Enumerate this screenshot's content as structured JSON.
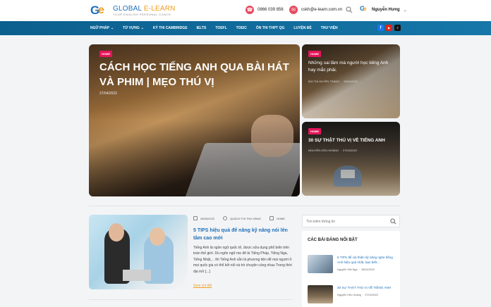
{
  "brand": {
    "logo_title": "GLOBAL",
    "logo_title_hl": "E-LEARN",
    "logo_sub": "YOUR ENGLISH PERSONAL COACH"
  },
  "header": {
    "phone": "0866 039 856",
    "email": "cskh@e-learn.com.vn",
    "user_name": "Nguyễn Hưng"
  },
  "nav": {
    "items": [
      {
        "label": "NGỮ PHÁP",
        "dropdown": true
      },
      {
        "label": "TỪ VỰNG",
        "dropdown": true
      },
      {
        "label": "KỲ THI CAMBRIDGE",
        "dropdown": false
      },
      {
        "label": "IELTS",
        "dropdown": false
      },
      {
        "label": "TOEFL",
        "dropdown": false
      },
      {
        "label": "TOEIC",
        "dropdown": false
      },
      {
        "label": "ÔN THI THPT QG",
        "dropdown": false
      },
      {
        "label": "LUYỆN ĐỀ",
        "dropdown": false
      },
      {
        "label": "THƯ VIỆN",
        "dropdown": false
      }
    ],
    "social": [
      {
        "name": "facebook-icon",
        "glyph": "f",
        "color": "#1877f2"
      },
      {
        "name": "youtube-icon",
        "glyph": "▶",
        "color": "#e62117"
      },
      {
        "name": "tiktok-icon",
        "glyph": "♪",
        "color": "#111111"
      }
    ]
  },
  "hero": {
    "main": {
      "tag": "HOME",
      "title": "CÁCH HỌC TIẾNG ANH QUA BÀI HÁT VÀ PHIM | MẸO THÚ VỊ",
      "date": "27/04/2022"
    },
    "side_a": {
      "tag": "HOME",
      "title": "Những sai lầm mà người học tiếng Anh hay mắc phải.",
      "author": "BÙI THỊ HUYỀN TRANG",
      "date": "28/04/2022"
    },
    "side_b": {
      "tag": "HOME",
      "title": "30 SỰ THẬT THÚ VỊ VỀ TIẾNG ANH",
      "author": "NGUYỄN HỮU HOÀNG",
      "date": "27/04/2022"
    }
  },
  "post": {
    "date": "28/06/2022",
    "author": "QUÁCH THỊ THU HẰNG",
    "category": "HOME",
    "title": "5 TIPS hiệu quả để nâng kỹ năng nói lên tầm cao mới",
    "excerpt": "Tiếng Anh là ngôn ngữ quốc tế, được sửa dụng phổ biến trên toàn thế giới. Dù ngôn ngữ mẹ đẻ là Tiếng Pháp, Tiếng Nga, Tiếng Nhật,... thì Tiếng Anh vẫn là phương tiện để mọi người ở mọi quốc gia có thể kết nối và trò chuyện cùng nhau Trong thời đại mở [...]",
    "read_more": "Xem chi tiết"
  },
  "sidebar": {
    "search_placeholder": "Tìm kiếm thông tin",
    "featured_title": "CÁC BÀI ĐĂNG NỔI BẬT",
    "items": [
      {
        "title": "5 TIPS để cải thiện kỹ năng nghe tiếng Anh hiệu quả nhất, bạn biết...",
        "author": "Nguyễn Việt Nga",
        "date": "28/04/2022"
      },
      {
        "title": "30 SỰ THẬT THÚ VỊ VỀ TIẾNG ANH",
        "author": "Nguyễn Hữu Hoàng",
        "date": "27/04/2022"
      }
    ]
  }
}
